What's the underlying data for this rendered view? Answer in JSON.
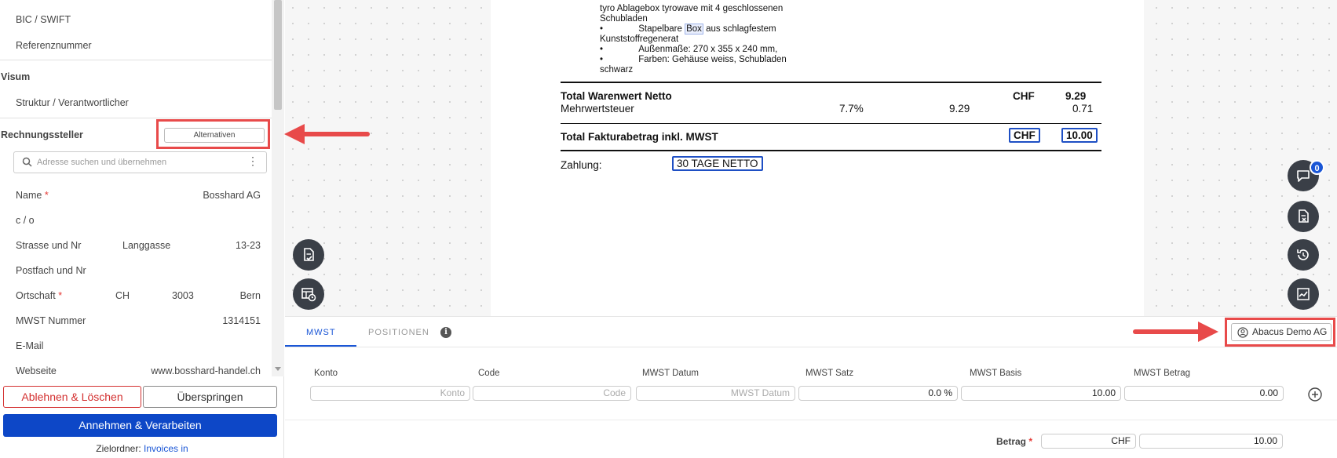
{
  "sidebar": {
    "bic": "BIC / SWIFT",
    "referenz": "Referenznummer",
    "visum_title": "Visum",
    "struktur": "Struktur / Verantwortlicher",
    "rechnungssteller_title": "Rechnungssteller",
    "alternativen": "Alternativen",
    "search_placeholder": "Adresse suchen und übernehmen",
    "name_label": "Name",
    "name_value": "Bosshard AG",
    "co_label": "c / o",
    "strasse_label": "Strasse und Nr",
    "strasse_value": "Langgasse",
    "strasse_nr": "13-23",
    "postfach_label": "Postfach und Nr",
    "ortschaft_label": "Ortschaft",
    "land": "CH",
    "plz": "3003",
    "ort": "Bern",
    "mwst_label": "MWST Nummer",
    "mwst_value": "1314151",
    "email_label": "E-Mail",
    "webseite_label": "Webseite",
    "webseite_value": "www.bosshard-handel.ch",
    "required_mark": "*"
  },
  "actions": {
    "reject": "Ablehnen & Löschen",
    "skip": "Überspringen",
    "accept": "Annehmen & Verarbeiten",
    "target_label": "Zielordner:",
    "target_link": "Invoices in"
  },
  "document": {
    "lines": [
      "tyro Ablagebox tyrowave mit 4 geschlossenen",
      "Schubladen",
      "•",
      "Stapelbare",
      "Box",
      "aus schlagfestem",
      "Kunststoffregenerat",
      "•",
      "Außenmaße: 270 x 355 x 240 mm,",
      "•",
      "Farben: Gehäuse weiss, Schubladen",
      "schwarz"
    ],
    "total_netto_label": "Total Warenwert Netto",
    "total_netto_cur": "CHF",
    "total_netto_val": "9.29",
    "mwst_label": "Mehrwertsteuer",
    "mwst_rate": "7.7%",
    "mwst_basis": "9.29",
    "mwst_val": "0.71",
    "total_inkl_label": "Total Fakturabetrag inkl. MWST",
    "total_inkl_cur": "CHF",
    "total_inkl_val": "10.00",
    "zahlung_label": "Zahlung:",
    "zahlung_val": "30 TAGE NETTO"
  },
  "fabs": {
    "comment_badge": "0"
  },
  "bottom": {
    "tab_mwst": "MWST",
    "tab_positionen": "POSITIONEN",
    "info": "i",
    "company": "Abacus Demo AG",
    "columns": [
      "Konto",
      "Code",
      "MWST Datum",
      "MWST Satz",
      "MWST Basis",
      "MWST Betrag"
    ],
    "row": {
      "konto_ph": "Konto",
      "code_ph": "Code",
      "datum_ph": "MWST Datum",
      "satz": "0.0 %",
      "basis": "10.00",
      "betrag": "0.00"
    },
    "betrag_label": "Betrag",
    "betrag_cur": "CHF",
    "betrag_val": "10.00"
  },
  "colors": {
    "accent": "#1a56d6",
    "primary_button": "#0d47c7",
    "danger": "#d32f2f",
    "annotation": "#e84a4a"
  }
}
